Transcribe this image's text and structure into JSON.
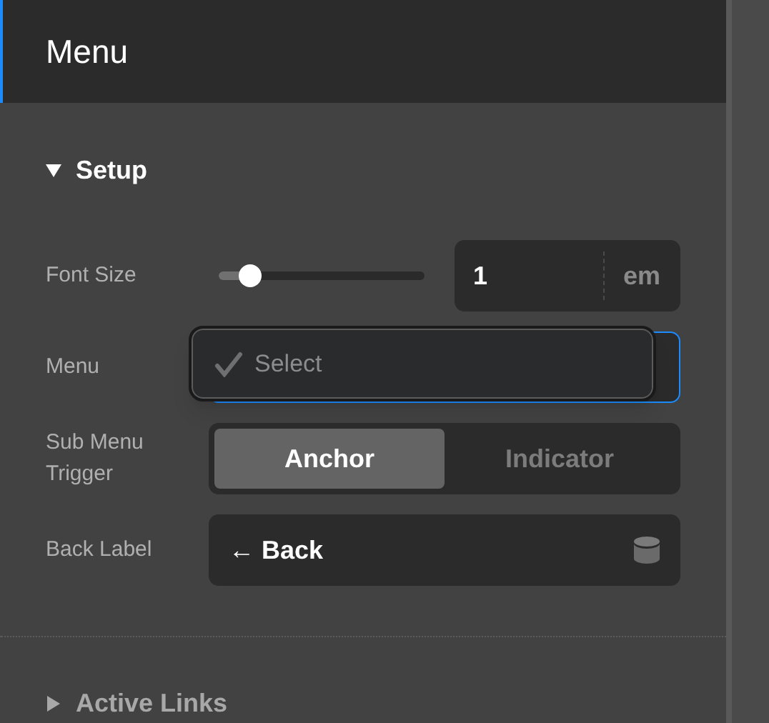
{
  "panel": {
    "title": "Menu"
  },
  "sections": [
    {
      "title": "Setup",
      "expanded": true
    },
    {
      "title": "Active Links",
      "expanded": false
    }
  ],
  "font_size": {
    "label": "Font Size",
    "level": 0.15,
    "value": "1",
    "unit": "em"
  },
  "menu": {
    "label": "Menu",
    "options": [
      {
        "label": "Select",
        "checked": true
      }
    ]
  },
  "sub_menu_trigger": {
    "label": "Sub Menu Trigger",
    "options": [
      {
        "label": "Anchor",
        "selected": true
      },
      {
        "label": "Indicator",
        "selected": false
      }
    ]
  },
  "back_label": {
    "label": "Back Label",
    "value": "← Back"
  }
}
